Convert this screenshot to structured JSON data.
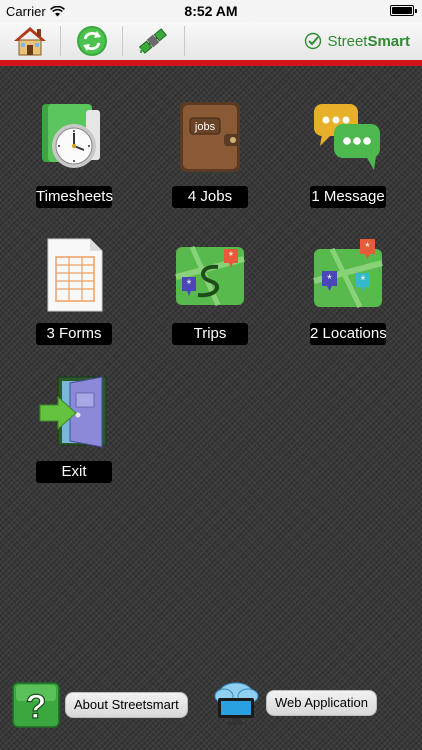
{
  "status_bar": {
    "carrier": "Carrier",
    "time": "8:52 AM"
  },
  "toolbar": {
    "home_icon": "home-icon",
    "sync_icon": "sync-icon",
    "satellite_icon": "satellite-icon",
    "brand": {
      "part1": "Street",
      "part2": "Smart"
    }
  },
  "tiles": [
    {
      "label": "Timesheets",
      "icon": "clock-icon"
    },
    {
      "label": "4 Jobs",
      "icon": "jobs-wallet-icon",
      "icon_text": "jobs"
    },
    {
      "label": "1 Message",
      "icon": "message-bubbles-icon"
    },
    {
      "label": "3 Forms",
      "icon": "form-document-icon"
    },
    {
      "label": "Trips",
      "icon": "trips-map-icon"
    },
    {
      "label": "2 Locations",
      "icon": "locations-map-icon"
    },
    {
      "label": "Exit",
      "icon": "exit-door-icon"
    }
  ],
  "bottom": {
    "about_label": "About Streetsmart",
    "about_icon": "question-icon",
    "web_label": "Web Application",
    "web_icon": "cloud-monitor-icon",
    "question_mark": "?"
  },
  "colors": {
    "accent_red": "#d4141b",
    "brand_green": "#2f8a32"
  }
}
